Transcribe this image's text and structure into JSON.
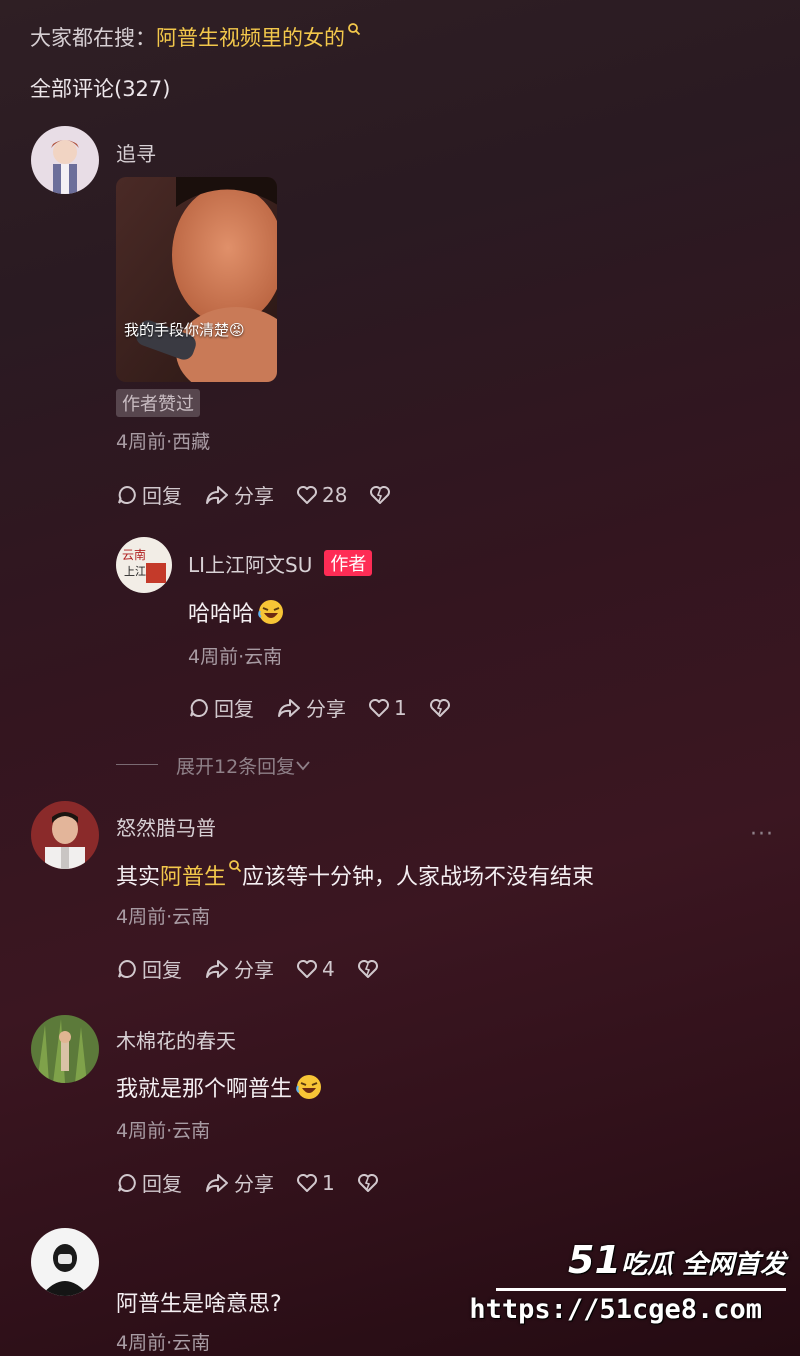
{
  "search_hint": {
    "label": "大家都在搜：",
    "keyword": "阿普生视频里的女的"
  },
  "comments_header": "全部评论(327)",
  "actions": {
    "reply": "回复",
    "share": "分享"
  },
  "comments": [
    {
      "username": "追寻",
      "image_caption": "我的手段你清楚😡",
      "badge": "作者赞过",
      "meta": "4周前·西藏",
      "likes": "28",
      "replies": [
        {
          "username": "LI上江阿文SU",
          "tag": "作者",
          "text": "哈哈哈",
          "meta": "4周前·云南",
          "likes": "1"
        }
      ],
      "expand": "展开12条回复"
    },
    {
      "username": "怒然腊马普",
      "text_before": "其实",
      "text_keyword": "阿普生",
      "text_after": "应该等十分钟，人家战场不没有结束",
      "meta": "4周前·云南",
      "likes": "4",
      "more": "···"
    },
    {
      "username": "木棉花的春天",
      "text": "我就是那个啊普生",
      "meta": "4周前·云南",
      "likes": "1"
    },
    {
      "username": "",
      "text": "阿普生是啥意思?",
      "meta": "4周前·云南"
    }
  ],
  "watermark": {
    "brand_number": "51",
    "brand_text": "吃瓜 全网首发",
    "url": "https://51cge8.com"
  },
  "colors": {
    "keyword": "#f3c84b",
    "author_tag": "#fe2c55"
  }
}
